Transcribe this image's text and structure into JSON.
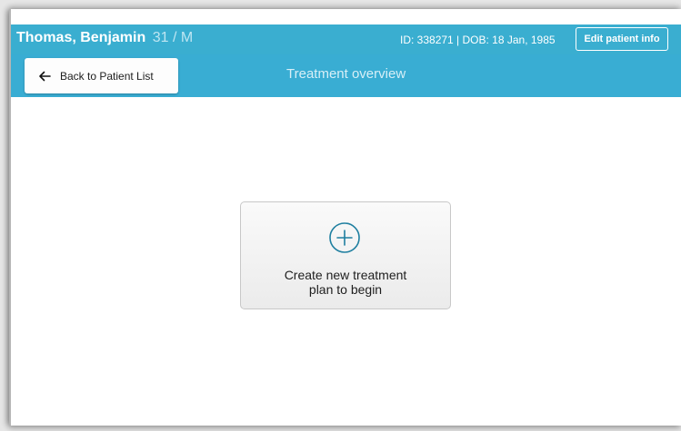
{
  "patient": {
    "name": "Thomas, Benjamin",
    "age_sex": "31 / M",
    "id_dob": "ID: 338271 | DOB: 18 Jan, 1985"
  },
  "header": {
    "edit_label": "Edit patient info"
  },
  "nav": {
    "back_label": "Back to Patient List",
    "back_icon": "arrow-left-icon",
    "title": "Treatment overview"
  },
  "main": {
    "create_card": {
      "icon": "plus-circle-icon",
      "line1": "Create new treatment",
      "line2": "plan to begin"
    }
  },
  "colors": {
    "header_bg": "#3aaed0",
    "accent": "#1f7fa0"
  }
}
